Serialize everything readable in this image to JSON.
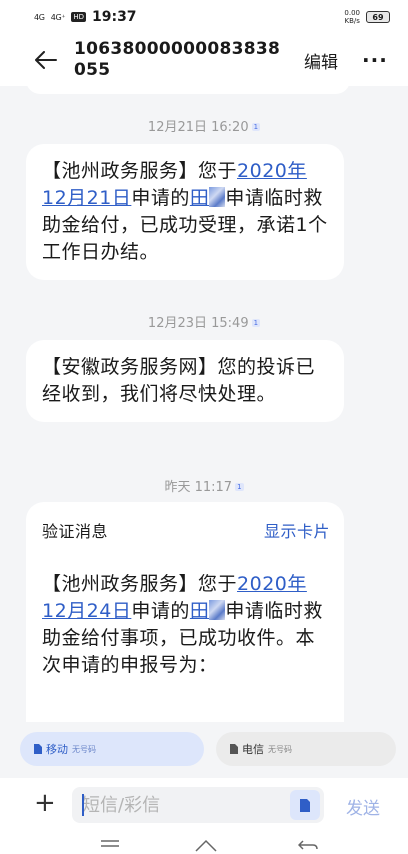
{
  "status_bar": {
    "signal1": "4G",
    "signal2": "4G⁺",
    "hd": "HD",
    "time": "19:37",
    "speed_value": "0.00",
    "speed_unit": "KB/s",
    "battery": "69"
  },
  "header": {
    "title": "10638000000083838055",
    "edit_label": "编辑",
    "more_label": "···"
  },
  "messages": [
    {
      "timestamp": "12月21日 16:20",
      "sim_badge": "1",
      "prefix": "【池州政务服务】您于",
      "date_link": "2020年12月21日",
      "mid": "申请的",
      "name_link": "田",
      "suffix": "申请临时救助金给付，已成功受理，承诺1个工作日办结。"
    },
    {
      "timestamp": "12月23日 15:49",
      "sim_badge": "1",
      "text": "【安徽政务服务网】您的投诉已经收到，我们将尽快处理。"
    },
    {
      "timestamp": "昨天 11:17",
      "sim_badge": "1",
      "card_title": "验证消息",
      "card_action": "显示卡片",
      "prefix": "【池州政务服务】您于",
      "date_link": "2020年12月24日",
      "mid": "申请的",
      "name_link": "田",
      "suffix": "申请临时救助金给付事项，已成功收件。本次申请的申报号为："
    }
  ],
  "sim_bar": {
    "sim1_name": "移动",
    "sim1_sub": "无号码",
    "sim2_name": "电信",
    "sim2_sub": "无号码"
  },
  "composer": {
    "placeholder": "短信/彩信",
    "send_label": "发送"
  },
  "colors": {
    "accent": "#2f5ec7",
    "background": "#f4f5f7",
    "bubble": "#ffffff"
  }
}
